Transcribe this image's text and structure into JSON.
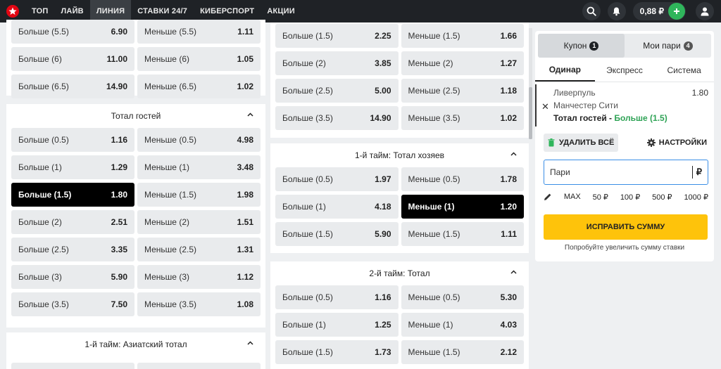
{
  "nav": {
    "items": [
      {
        "label": "ТОП",
        "active": false
      },
      {
        "label": "ЛАЙВ",
        "active": false
      },
      {
        "label": "ЛИНИЯ",
        "active": true
      },
      {
        "label": "СТАВКИ 24/7",
        "active": false
      },
      {
        "label": "КИБЕРСПОРТ",
        "active": false
      },
      {
        "label": "АКЦИИ",
        "active": false
      }
    ],
    "balance": "0,88 ₽"
  },
  "colors": {
    "brand_red": "#e30613",
    "accent_green": "#2fb55b",
    "accent_yellow": "#fec30b",
    "dark": "#1f2226"
  },
  "column1": [
    {
      "title": "",
      "rows": [
        [
          {
            "label": "Больше (5.5)",
            "odd": "6.90"
          },
          {
            "label": "Меньше (5.5)",
            "odd": "1.11"
          }
        ],
        [
          {
            "label": "Больше (6)",
            "odd": "11.00"
          },
          {
            "label": "Меньше (6)",
            "odd": "1.05"
          }
        ],
        [
          {
            "label": "Больше (6.5)",
            "odd": "14.90"
          },
          {
            "label": "Меньше (6.5)",
            "odd": "1.02"
          }
        ]
      ]
    },
    {
      "title": "Тотал гостей",
      "rows": [
        [
          {
            "label": "Больше (0.5)",
            "odd": "1.16"
          },
          {
            "label": "Меньше (0.5)",
            "odd": "4.98"
          }
        ],
        [
          {
            "label": "Больше (1)",
            "odd": "1.29"
          },
          {
            "label": "Меньше (1)",
            "odd": "3.48"
          }
        ],
        [
          {
            "label": "Больше (1.5)",
            "odd": "1.80",
            "selected": true
          },
          {
            "label": "Меньше (1.5)",
            "odd": "1.98"
          }
        ],
        [
          {
            "label": "Больше (2)",
            "odd": "2.51"
          },
          {
            "label": "Меньше (2)",
            "odd": "1.51"
          }
        ],
        [
          {
            "label": "Больше (2.5)",
            "odd": "3.35"
          },
          {
            "label": "Меньше (2.5)",
            "odd": "1.31"
          }
        ],
        [
          {
            "label": "Больше (3)",
            "odd": "5.90"
          },
          {
            "label": "Меньше (3)",
            "odd": "1.12"
          }
        ],
        [
          {
            "label": "Больше (3.5)",
            "odd": "7.50"
          },
          {
            "label": "Меньше (3.5)",
            "odd": "1.08"
          }
        ]
      ]
    },
    {
      "title": "1-й тайм: Азиатский тотал",
      "rows": [
        [
          {
            "label": "",
            "odd": ""
          },
          {
            "label": "",
            "odd": ""
          }
        ]
      ]
    }
  ],
  "column2": [
    {
      "title": "",
      "rows": [
        [
          {
            "label": "Больше (1.5)",
            "odd": "2.25"
          },
          {
            "label": "Меньше (1.5)",
            "odd": "1.66"
          }
        ],
        [
          {
            "label": "Больше (2)",
            "odd": "3.85"
          },
          {
            "label": "Меньше (2)",
            "odd": "1.27"
          }
        ],
        [
          {
            "label": "Больше (2.5)",
            "odd": "5.00"
          },
          {
            "label": "Меньше (2.5)",
            "odd": "1.18"
          }
        ],
        [
          {
            "label": "Больше (3.5)",
            "odd": "14.90"
          },
          {
            "label": "Меньше (3.5)",
            "odd": "1.02"
          }
        ]
      ]
    },
    {
      "title": "1-й тайм: Тотал хозяев",
      "rows": [
        [
          {
            "label": "Больше (0.5)",
            "odd": "1.97"
          },
          {
            "label": "Меньше (0.5)",
            "odd": "1.78"
          }
        ],
        [
          {
            "label": "Больше (1)",
            "odd": "4.18"
          },
          {
            "label": "Меньше (1)",
            "odd": "1.20",
            "selected": true
          }
        ],
        [
          {
            "label": "Больше (1.5)",
            "odd": "5.90"
          },
          {
            "label": "Меньше (1.5)",
            "odd": "1.11"
          }
        ]
      ]
    },
    {
      "title": "2-й тайм: Тотал",
      "rows": [
        [
          {
            "label": "Больше (0.5)",
            "odd": "1.16"
          },
          {
            "label": "Меньше (0.5)",
            "odd": "5.30"
          }
        ],
        [
          {
            "label": "Больше (1)",
            "odd": "1.25"
          },
          {
            "label": "Меньше (1)",
            "odd": "4.03"
          }
        ],
        [
          {
            "label": "Больше (1.5)",
            "odd": "1.73"
          },
          {
            "label": "Меньше (1.5)",
            "odd": "2.12"
          }
        ]
      ]
    }
  ],
  "coupon": {
    "segment": [
      {
        "label": "Купон",
        "count": "1",
        "active": true
      },
      {
        "label": "Мои пари",
        "count": "4",
        "active": false
      }
    ],
    "tabs": [
      {
        "label": "Одинар",
        "active": true
      },
      {
        "label": "Экспресс",
        "active": false
      },
      {
        "label": "Система",
        "active": false
      }
    ],
    "bet": {
      "team1": "Ливерпуль",
      "team2": "Манчестер Сити",
      "odd": "1.80",
      "market": "Тотал гостей - ",
      "pick": "Больше (1.5)"
    },
    "delete_label": "УДАЛИТЬ ВСЁ",
    "settings_label": "НАСТРОЙКИ",
    "stake_placeholder": "Пари",
    "currency": "₽",
    "quick_amounts": [
      "MAX",
      "50 ₽",
      "100 ₽",
      "500 ₽",
      "1000 ₽"
    ],
    "fix_label": "ИСПРАВИТЬ СУММУ",
    "hint": "Попробуйте увеличить сумму ставки"
  }
}
